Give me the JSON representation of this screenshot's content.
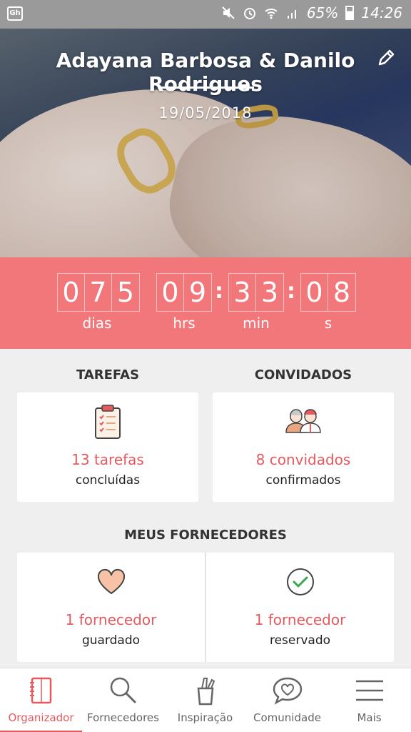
{
  "status_bar": {
    "battery": "65%",
    "time": "14:26"
  },
  "hero": {
    "couple_names": "Adayana Barbosa & Danilo Rodrigues",
    "wedding_date": "19/05/2018"
  },
  "countdown": {
    "days_digits": [
      "0",
      "7",
      "5"
    ],
    "hours_digits": [
      "0",
      "9"
    ],
    "minutes_digits": [
      "3",
      "3"
    ],
    "seconds_digits": [
      "0",
      "8"
    ],
    "separator": ":",
    "days_label": "dias",
    "hours_label": "hrs",
    "minutes_label": "min",
    "seconds_label": "s"
  },
  "tasks": {
    "title": "TAREFAS",
    "count": "13 tarefas",
    "status": "concluídas"
  },
  "guests": {
    "title": "CONVIDADOS",
    "count": "8 convidados",
    "status": "confirmados"
  },
  "vendors": {
    "title": "MEUS FORNECEDORES",
    "saved_count": "1 fornecedor",
    "saved_status": "guardado",
    "booked_count": "1 fornecedor",
    "booked_status": "reservado"
  },
  "bottom_nav": {
    "items": [
      {
        "label": "Organizador",
        "icon": "notebook-icon",
        "active": true
      },
      {
        "label": "Fornecedores",
        "icon": "search-icon",
        "active": false
      },
      {
        "label": "Inspiração",
        "icon": "pencil-cup-icon",
        "active": false
      },
      {
        "label": "Comunidade",
        "icon": "chat-heart-icon",
        "active": false
      },
      {
        "label": "Mais",
        "icon": "menu-icon",
        "active": false
      }
    ]
  },
  "colors": {
    "accent": "#e45a5f",
    "countdown_bg": "#f2777a"
  }
}
